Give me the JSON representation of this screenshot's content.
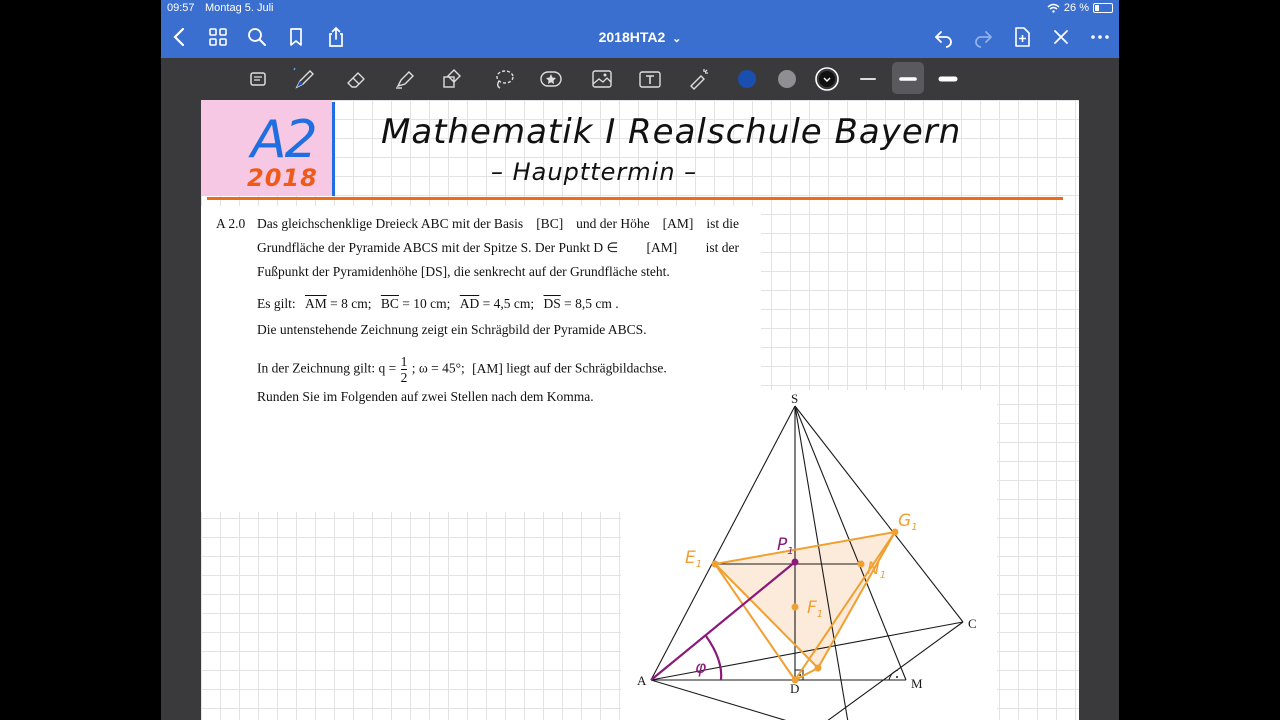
{
  "status": {
    "time": "09:57",
    "date": "Montag 5. Juli",
    "battery": "26 %",
    "battery_level": 0.26
  },
  "nav": {
    "title": "2018HTA2",
    "title_chevron": "⌄"
  },
  "toolbar": {
    "pen_color": "#1a4fb0",
    "gray_color": "#8e8e93",
    "black_color": "#111111"
  },
  "header": {
    "badge_task": "A2",
    "badge_year": "2018",
    "title": "Mathematik I Realschule Bayern",
    "subtitle": "– Haupttermin –",
    "colors": {
      "pink": "#f7c8e4",
      "blue": "#1f6fe0",
      "orange": "#f06a1a"
    }
  },
  "task": {
    "number": "A 2.0",
    "line1_a": "Das gleichschenklige Dreieck ABC mit der Basis",
    "line1_b": "[BC]",
    "line1_c": "und der Höhe",
    "line1_d": "[AM]",
    "line1_e": "ist die",
    "line2_a": "Grundfläche der Pyramide ABCS mit der Spitze S. Der Punkt D ∈",
    "line2_b": "[AM]",
    "line2_c": "ist der",
    "line3_a": "Fußpunkt der Pyramidenhöhe",
    "line3_b": "[DS]",
    "line3_c": ", die senkrecht auf der Grundfläche steht.",
    "es_gilt": "Es gilt:",
    "m1_var": "AM",
    "m1_val": "= 8 cm;",
    "m2_var": "BC",
    "m2_val": "= 10 cm;",
    "m3_var": "AD",
    "m3_val": "= 4,5 cm;",
    "m4_var": "DS",
    "m4_val": "= 8,5 cm .",
    "line5": "Die untenstehende Zeichnung zeigt ein Schrägbild der Pyramide ABCS.",
    "line6_a": "In der Zeichnung gilt:  q =",
    "frac_num": "1",
    "frac_den": "2",
    "line6_b": "; ω = 45°;",
    "line6_c": "[AM]",
    "line6_d": "liegt auf der Schrägbildachse.",
    "line7": "Runden Sie im Folgenden auf zwei Stellen nach dem Komma."
  },
  "figure": {
    "labels": {
      "S": "S",
      "A": "A",
      "C": "C",
      "D": "D",
      "M": "M"
    },
    "hw_labels": {
      "E1": "E",
      "E1_sub": "1",
      "G1": "G",
      "G1_sub": "1",
      "N1": "N",
      "N1_sub": "1",
      "F1": "F",
      "F1_sub": "1",
      "P1": "P",
      "P1_sub": "1",
      "phi": "φ"
    },
    "colors": {
      "orange": "#f0a030",
      "purple": "#8a1a7a",
      "fill": "#fbe6d4"
    }
  }
}
